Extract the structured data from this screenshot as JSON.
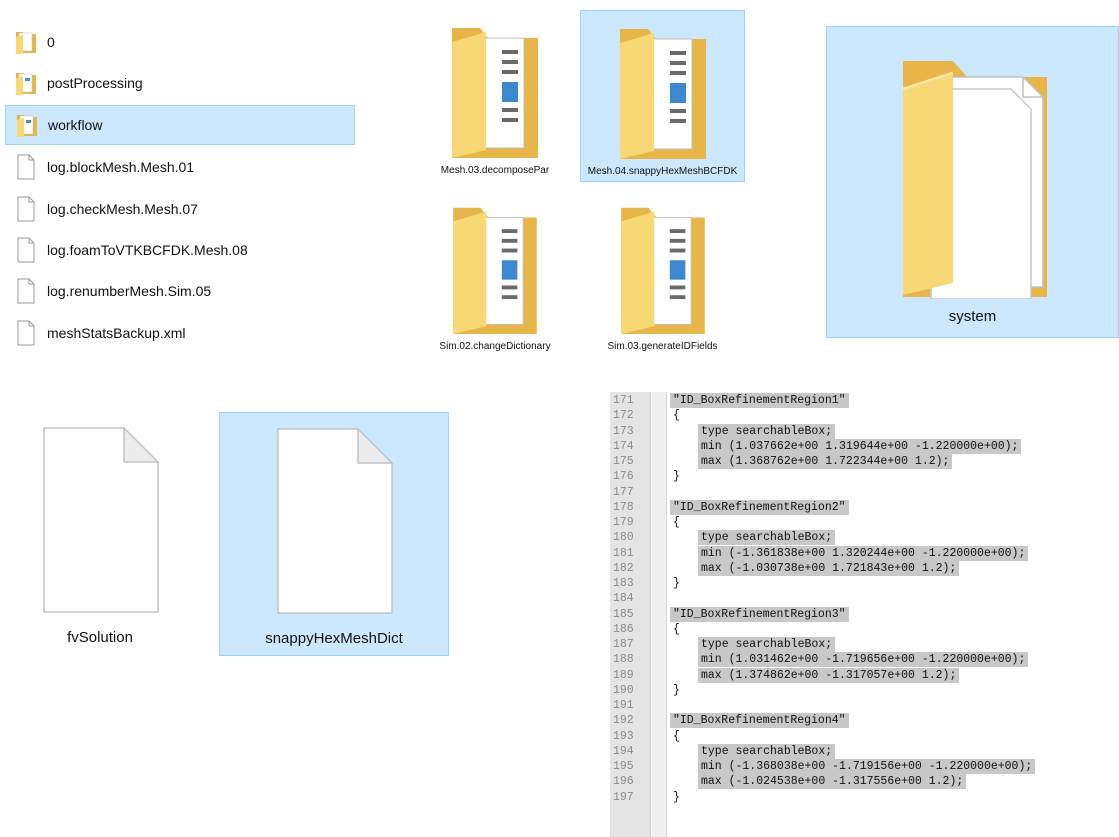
{
  "list_view": {
    "items": [
      {
        "label": "0",
        "type": "folder-doc",
        "selected": false
      },
      {
        "label": "postProcessing",
        "type": "folder-doc",
        "selected": false
      },
      {
        "label": "workflow",
        "type": "folder-doc",
        "selected": true
      },
      {
        "label": "log.blockMesh.Mesh.01",
        "type": "file",
        "selected": false
      },
      {
        "label": "log.checkMesh.Mesh.07",
        "type": "file",
        "selected": false
      },
      {
        "label": "log.foamToVTKBCFDK.Mesh.08",
        "type": "file",
        "selected": false
      },
      {
        "label": "log.renumberMesh.Sim.05",
        "type": "file",
        "selected": false
      },
      {
        "label": "meshStatsBackup.xml",
        "type": "file",
        "selected": false
      }
    ]
  },
  "workflow_folders": [
    {
      "label": "Mesh.03.decomposePar",
      "selected": false
    },
    {
      "label": "Mesh.04.snappyHexMeshBCFDK",
      "selected": true
    },
    {
      "label": "Sim.02.changeDictionary",
      "selected": false
    },
    {
      "label": "Sim.03.generateIDFields",
      "selected": false
    }
  ],
  "system_folder": {
    "label": "system",
    "selected": true
  },
  "system_files": [
    {
      "label": "fvSolution",
      "selected": false
    },
    {
      "label": "snappyHexMeshDict",
      "selected": true
    }
  ],
  "editor": {
    "lines": [
      {
        "n": "171",
        "text": "\"ID_BoxRefinementRegion1\"",
        "indent": 0,
        "hl": true
      },
      {
        "n": "172",
        "text": "{",
        "indent": 0,
        "hl": false
      },
      {
        "n": "173",
        "text": "type searchableBox;",
        "indent": 1,
        "hl": true
      },
      {
        "n": "174",
        "text": "min (1.037662e+00 1.319644e+00 -1.220000e+00);",
        "indent": 1,
        "hl": true
      },
      {
        "n": "175",
        "text": "max (1.368762e+00 1.722344e+00 1.2);",
        "indent": 1,
        "hl": true
      },
      {
        "n": "176",
        "text": "}",
        "indent": 0,
        "hl": false
      },
      {
        "n": "177",
        "text": "",
        "indent": 0,
        "hl": false
      },
      {
        "n": "178",
        "text": "\"ID_BoxRefinementRegion2\"",
        "indent": 0,
        "hl": true
      },
      {
        "n": "179",
        "text": "{",
        "indent": 0,
        "hl": false
      },
      {
        "n": "180",
        "text": "type searchableBox;",
        "indent": 1,
        "hl": true
      },
      {
        "n": "181",
        "text": "min (-1.361838e+00 1.320244e+00 -1.220000e+00);",
        "indent": 1,
        "hl": true
      },
      {
        "n": "182",
        "text": "max (-1.030738e+00 1.721843e+00 1.2);",
        "indent": 1,
        "hl": true
      },
      {
        "n": "183",
        "text": "}",
        "indent": 0,
        "hl": false
      },
      {
        "n": "184",
        "text": "",
        "indent": 0,
        "hl": false
      },
      {
        "n": "185",
        "text": "\"ID_BoxRefinementRegion3\"",
        "indent": 0,
        "hl": true
      },
      {
        "n": "186",
        "text": "{",
        "indent": 0,
        "hl": false
      },
      {
        "n": "187",
        "text": "type searchableBox;",
        "indent": 1,
        "hl": true
      },
      {
        "n": "188",
        "text": "min (1.031462e+00 -1.719656e+00 -1.220000e+00);",
        "indent": 1,
        "hl": true
      },
      {
        "n": "189",
        "text": "max (1.374862e+00 -1.317057e+00 1.2);",
        "indent": 1,
        "hl": true
      },
      {
        "n": "190",
        "text": "}",
        "indent": 0,
        "hl": false
      },
      {
        "n": "191",
        "text": "",
        "indent": 0,
        "hl": false
      },
      {
        "n": "192",
        "text": "\"ID_BoxRefinementRegion4\"",
        "indent": 0,
        "hl": true
      },
      {
        "n": "193",
        "text": "{",
        "indent": 0,
        "hl": false
      },
      {
        "n": "194",
        "text": "type searchableBox;",
        "indent": 1,
        "hl": true
      },
      {
        "n": "195",
        "text": "min (-1.368038e+00 -1.719156e+00 -1.220000e+00);",
        "indent": 1,
        "hl": true
      },
      {
        "n": "196",
        "text": "max (-1.024538e+00 -1.317556e+00 1.2);",
        "indent": 1,
        "hl": true
      },
      {
        "n": "197",
        "text": "}",
        "indent": 0,
        "hl": false
      }
    ]
  },
  "colors": {
    "selection_bg": "#cce8ff",
    "selection_border": "#99d1ff",
    "folder_yellow": "#f8d775",
    "code_highlight": "#c8c8c8"
  }
}
